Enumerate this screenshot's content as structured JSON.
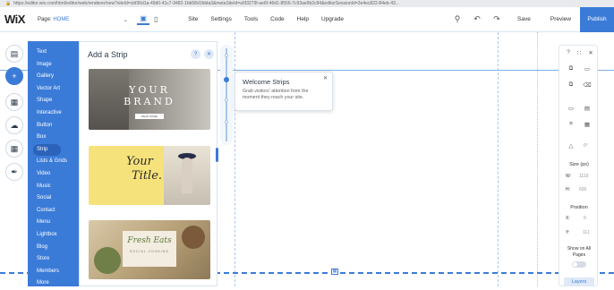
{
  "browser": {
    "url": "https://editor.wix.com/html/editor/web/renderer/new?siteId=cbf36d1a-49d0-41c7-9482-1bb58d1fdda3&metaSiteId=a5f3279f-ae6f-46d1-8556-7c93ae9b2c84&editorSessionId=3e4ec822-84eb-43..."
  },
  "topbar": {
    "logo": "WiX",
    "page_label": "Page:",
    "page_value": "HOME",
    "chevron_icon": "chevron-down-icon",
    "menu": [
      "Site",
      "Settings",
      "Tools",
      "Code",
      "Help",
      "Upgrade"
    ],
    "save": "Save",
    "preview": "Preview",
    "publish": "Publish",
    "accent": "#3b7bd8"
  },
  "add_panel": {
    "title": "Add a Strip",
    "categories": [
      "Text",
      "Image",
      "Gallery",
      "Vector Art",
      "Shape",
      "Interactive",
      "Button",
      "Box",
      "Strip",
      "Lists & Grids",
      "Video",
      "Music",
      "Social",
      "Contact",
      "Menu",
      "Lightbox",
      "Blog",
      "Store",
      "Members",
      "More"
    ],
    "selected": "Strip",
    "thumbs": [
      {
        "line1": "YOUR",
        "line2": "BRAND",
        "button": "READ MORE"
      },
      {
        "line1": "Your",
        "line2": "Title."
      },
      {
        "line1": "Fresh Eats",
        "line2": "SOCIAL COOKING"
      }
    ]
  },
  "tooltip": {
    "title": "Welcome Strips",
    "desc": "Grab visitors' attention from the moment they reach your site."
  },
  "inspector": {
    "size_label": "Size (px)",
    "w_label": "W:",
    "w_value": "1119",
    "h_label": "H:",
    "h_value": "600",
    "position_label": "Position",
    "x_label": "X:",
    "x_value": "0",
    "y_label": "Y:",
    "y_value": "111",
    "show_all_pages": "Show on All Pages",
    "layers": "Layers",
    "rotate_value": "0°"
  }
}
